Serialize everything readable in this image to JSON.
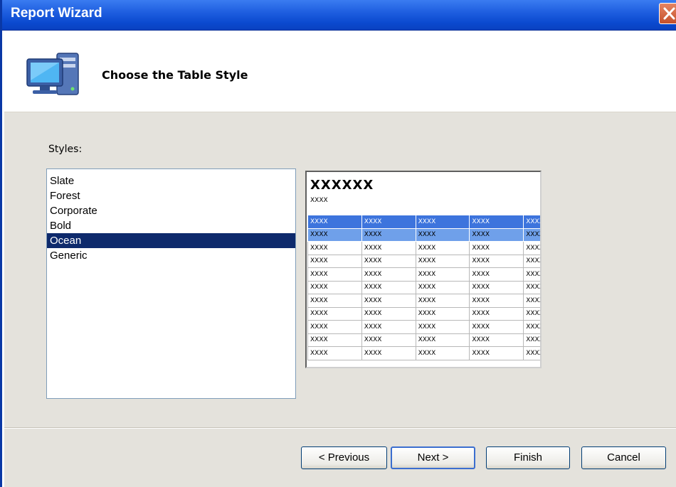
{
  "window": {
    "title": "Report Wizard"
  },
  "header": {
    "title": "Choose the Table Style"
  },
  "styles": {
    "label": "Styles:",
    "items": [
      "Slate",
      "Forest",
      "Corporate",
      "Bold",
      "Ocean",
      "Generic"
    ],
    "selected": "Ocean"
  },
  "preview": {
    "title": "XXXXXX",
    "subtitle": "XXXX",
    "cell_text": "XXXX",
    "header_color": "#3d74dd",
    "alt_row_color": "#6fa0ea"
  },
  "buttons": {
    "previous": "< Previous",
    "next": "Next >",
    "finish": "Finish",
    "cancel": "Cancel"
  }
}
